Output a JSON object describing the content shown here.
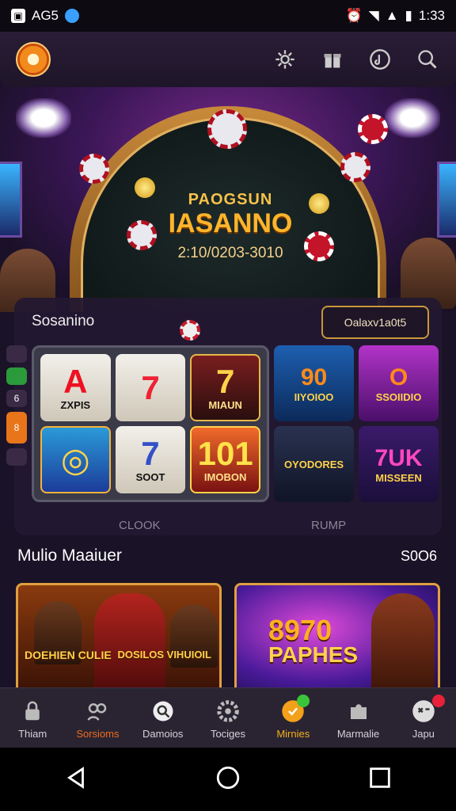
{
  "status": {
    "left_text": "AG5",
    "time": "1:33"
  },
  "hero": {
    "title": "PAOGSUN",
    "subtitle": "IASANNO",
    "date": "2:10/0203-3010"
  },
  "section": {
    "title": "Sosanino",
    "button": "Oalaxv1a0t5"
  },
  "rail": [
    "6",
    "8"
  ],
  "slots": [
    {
      "big": "A",
      "small": "ZXPIS"
    },
    {
      "big": "7",
      "small": ""
    },
    {
      "big": "7",
      "small": "MIAUN"
    },
    {
      "big": "◎",
      "small": ""
    },
    {
      "big": "7",
      "small": "SOOT"
    },
    {
      "big": "101",
      "small": "IMOBON"
    }
  ],
  "games": [
    {
      "big": "90",
      "label": "IIYOIOO"
    },
    {
      "big": "O",
      "label": "SSOIIDIO"
    },
    {
      "big": "",
      "label": "OYODORES"
    },
    {
      "big": "7UK",
      "label": "MISSEEN"
    }
  ],
  "labels": {
    "left": "CLOOK",
    "right": "RUMP"
  },
  "row": {
    "title": "Mulio Maaiuer",
    "more": "S0O6"
  },
  "cards": [
    {
      "t1": "DOEHIEN CULIE",
      "t2": "DOSILOS VIHUIOIL"
    },
    {
      "t1": "8970",
      "t2": "PAPHES"
    }
  ],
  "nav": [
    {
      "label": "Thiam",
      "icon": "lock-icon"
    },
    {
      "label": "Sorsioms",
      "icon": "people-icon",
      "active": true
    },
    {
      "label": "Damoios",
      "icon": "search-icon"
    },
    {
      "label": "Tociges",
      "icon": "gear-icon"
    },
    {
      "label": "Mirnies",
      "icon": "coin-icon"
    },
    {
      "label": "Marmalie",
      "icon": "puzzle-icon"
    },
    {
      "label": "Japu",
      "icon": "avatar-icon"
    }
  ],
  "colors": {
    "accent": "#f06a1a",
    "gold": "#f3b01a",
    "background": "#1a1226"
  }
}
